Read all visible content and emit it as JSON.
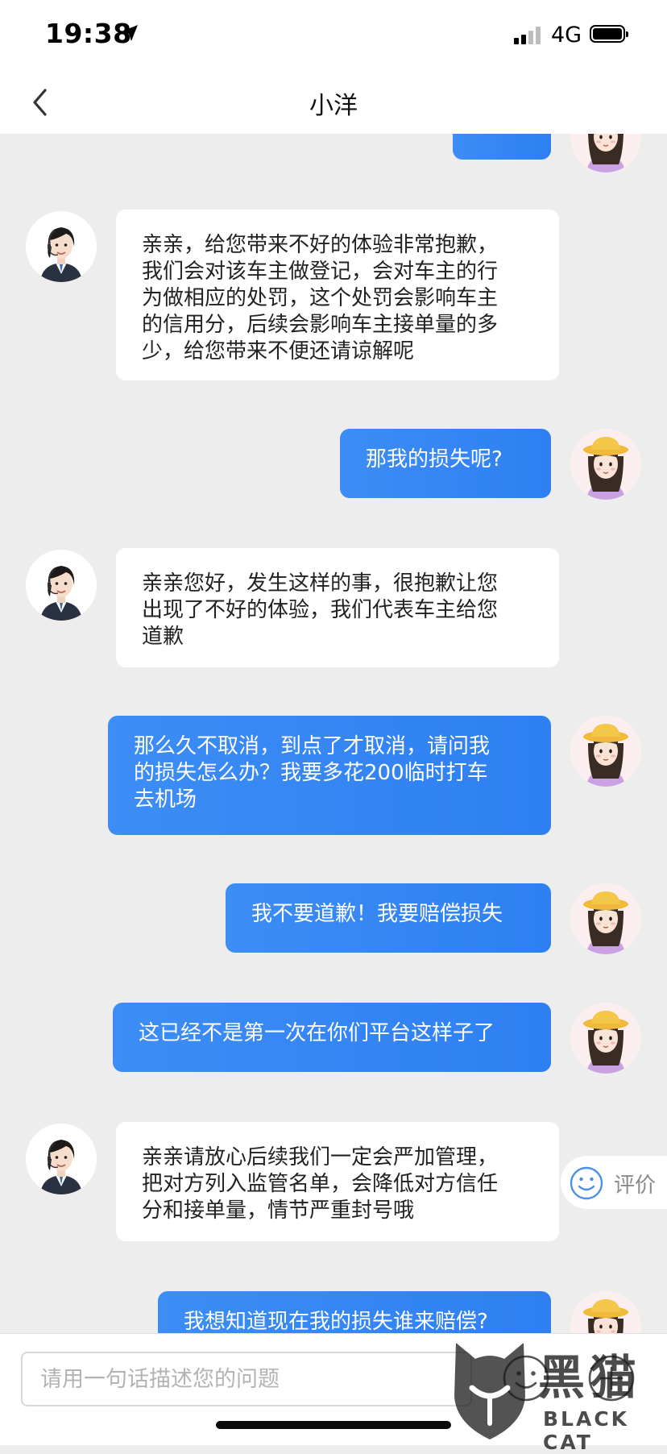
{
  "status_bar": {
    "time": "19:38",
    "network": "4G",
    "location_icon": "location-arrow-icon",
    "signal_icon": "cellular-signal-icon",
    "battery_icon": "battery-full-icon"
  },
  "nav": {
    "title": "小洋",
    "back_icon": "chevron-left-icon"
  },
  "messages": [
    {
      "sender": "agent",
      "text": "亲亲，给您带来不好的体验非常抱歉，\n我们会对该车主做登记，会对车主的行\n为做相应的处罚，这个处罚会影响车主\n的信用分，后续会影响车主接单量的多\n少，给您带来不便还请谅解呢"
    },
    {
      "sender": "user",
      "text": "那我的损失呢?"
    },
    {
      "sender": "agent",
      "text": "亲亲您好，发生这样的事，很抱歉让您\n出现了不好的体验，我们代表车主给您\n道歉"
    },
    {
      "sender": "user",
      "text": "那么久不取消，到点了才取消，请问我\n的损失怎么办？我要多花200临时打车\n去机场"
    },
    {
      "sender": "user",
      "text": "我不要道歉！我要赔偿损失"
    },
    {
      "sender": "user",
      "text": "这已经不是第一次在你们平台这样子了"
    },
    {
      "sender": "agent",
      "text": "亲亲请放心后续我们一定会严加管理，\n把对方列入监管名单，会降低对方信任\n分和接单量，情节严重封号哦"
    },
    {
      "sender": "user",
      "text": "我想知道现在我的损失谁来赔偿?"
    }
  ],
  "rating": {
    "label": "评价",
    "icon": "smiley-face-icon"
  },
  "input": {
    "placeholder": "请用一句话描述您的问题",
    "value": "",
    "emoji_icon": "emoji-icon",
    "plus_icon": "plus-icon"
  },
  "watermark": {
    "text_cn": "黑猫",
    "text_en": "BLACK CAT",
    "icon": "black-cat-logo-icon"
  },
  "colors": {
    "user_bubble": "#3d8df5",
    "agent_bubble": "#ffffff",
    "chat_background": "#ededed"
  }
}
